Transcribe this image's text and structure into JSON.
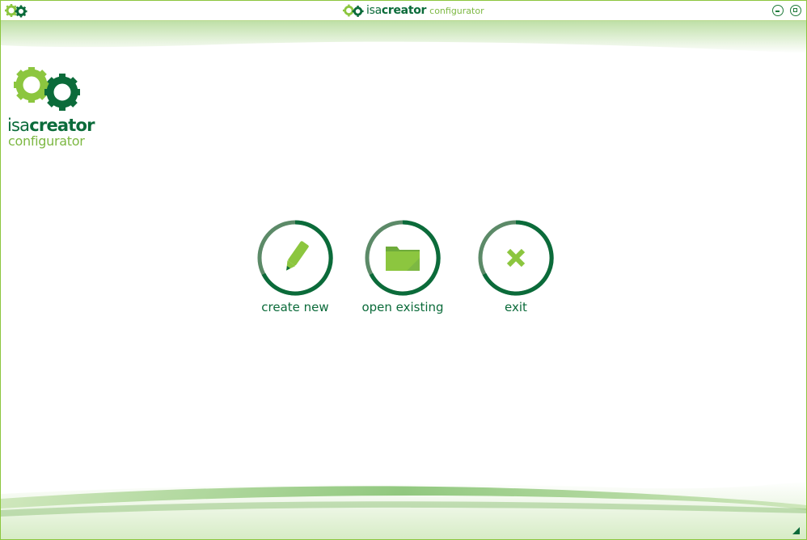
{
  "window": {
    "title_prefix": "isa",
    "title_bold": "creator",
    "title_suffix": "configurator",
    "minimize_icon": "minimize-icon",
    "maximize_icon": "maximize-icon"
  },
  "logo": {
    "line1_prefix": "isa",
    "line1_bold": "creator",
    "line2": "configurator"
  },
  "actions": [
    {
      "label": "create new",
      "icon": "pencil-icon"
    },
    {
      "label": "open existing",
      "icon": "folder-icon"
    },
    {
      "label": "exit",
      "icon": "x-icon"
    }
  ],
  "colors": {
    "dark_green": "#0b6b3a",
    "light_green": "#8cc63f",
    "ring_gray": "#5c8a68"
  }
}
